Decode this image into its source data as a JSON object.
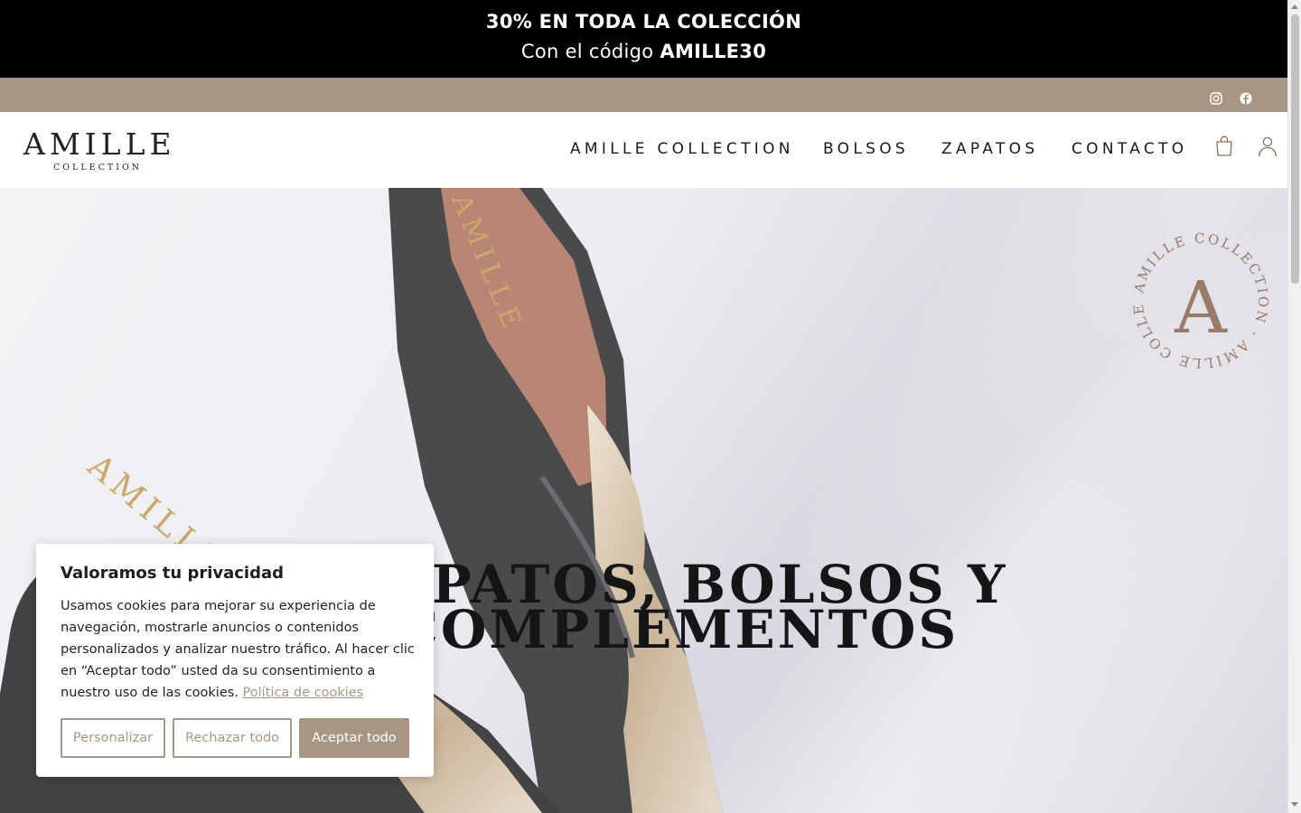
{
  "promo": {
    "title": "30% EN TODA LA COLECCIÓN",
    "code_prefix": "Con el código",
    "code": "AMILLE30"
  },
  "social": {
    "icons": [
      "instagram-icon",
      "facebook-icon"
    ]
  },
  "header": {
    "logo_main": "AMILLE",
    "logo_sub": "COLLECTION",
    "nav": [
      "AMILLE COLLECTION",
      "BOLSOS",
      "ZAPATOS",
      "CONTACTO"
    ],
    "icons": [
      "shopping-bag-icon",
      "user-account-icon"
    ]
  },
  "hero": {
    "heading_line1": "ZAPATOS, BOLSOS Y",
    "heading_line2": "COMPLEMENTOS",
    "badge_letter": "A",
    "badge_ring_text": "AMILLE COLLECTION · AMILLE COLLECTION ·",
    "shoe_brand": "AMILLE",
    "shoe_brand_sub": "COLLECTION"
  },
  "cookie": {
    "title": "Valoramos tu privacidad",
    "body": "Usamos cookies para mejorar su experiencia de navegación, mostrarle anuncios o contenidos personalizados y analizar nuestro tráfico. Al hacer clic en “Aceptar todo” usted da su consentimiento a nuestro uso de las cookies.",
    "policy_link": "Política de cookies",
    "buttons": {
      "customize": "Personalizar",
      "reject": "Rechazar todo",
      "accept": "Aceptar todo"
    }
  },
  "colors": {
    "accent": "#a79683",
    "promo_bg": "#000000",
    "badge": "#9a7a68"
  }
}
